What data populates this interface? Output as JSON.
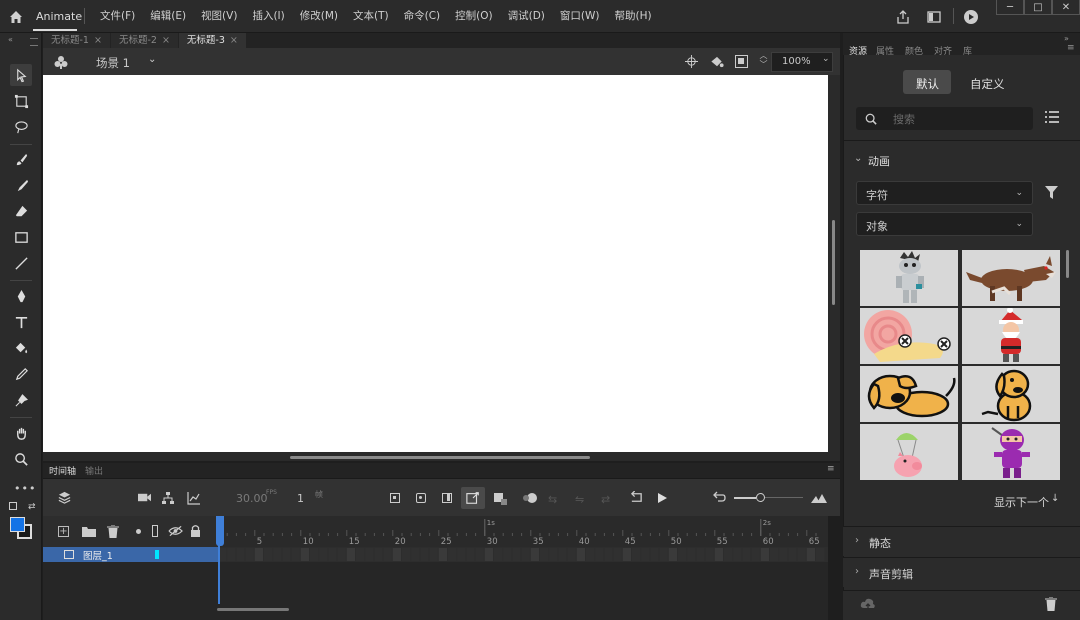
{
  "app": {
    "name": "Animate"
  },
  "menu": [
    "文件(F)",
    "编辑(E)",
    "视图(V)",
    "插入(I)",
    "修改(M)",
    "文本(T)",
    "命令(C)",
    "控制(O)",
    "调试(D)",
    "窗口(W)",
    "帮助(H)"
  ],
  "window_controls": [
    "─",
    "□",
    "✕"
  ],
  "doc_tabs": [
    {
      "label": "无标题-1",
      "close": "×"
    },
    {
      "label": "无标题-2",
      "close": "×"
    },
    {
      "label": "无标题-3",
      "close": "×"
    }
  ],
  "scene": {
    "label": "场景 1",
    "zoom": "100%"
  },
  "timeline": {
    "tabs": [
      "时间轴",
      "输出"
    ],
    "fps": "30.00",
    "fps_unit": "FPS",
    "frame": "1",
    "frame_unit": "帧",
    "ruler_seconds": [
      "1s",
      "2s"
    ],
    "ruler_frames": [
      "5",
      "10",
      "15",
      "20",
      "25",
      "30",
      "35",
      "40",
      "45",
      "50",
      "55",
      "60",
      "65"
    ],
    "layer_name": "图层_1"
  },
  "right_panel": {
    "tabs": [
      "资源",
      "属性",
      "颜色",
      "对齐",
      "库"
    ],
    "segments": [
      "默认",
      "自定义"
    ],
    "search_placeholder": "搜索",
    "section_animation": "动画",
    "dropdown_1": "字符",
    "dropdown_2": "对象",
    "thumbnails": [
      "zombie",
      "wolf",
      "snail",
      "santa",
      "dog-lying",
      "dog-sitting",
      "pig-parachute",
      "ninja"
    ],
    "show_next": "显示下一个",
    "section_static": "静态",
    "section_sound": "声音剪辑"
  },
  "colors": {
    "stroke": "#1a1a1a",
    "fill": "#1473e6",
    "accent": "#3f7fd8",
    "layer_highlight": "#3a67a8",
    "layer_color": "#00e5ff"
  }
}
